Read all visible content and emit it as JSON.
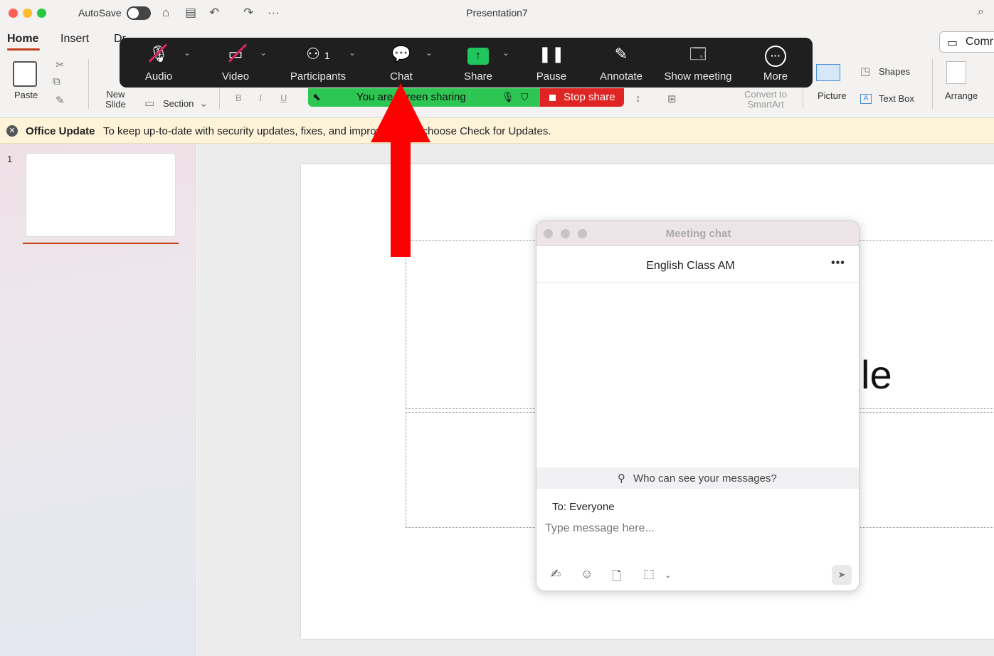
{
  "titlebar": {
    "autosave_label": "AutoSave",
    "more_glyph": "···",
    "document_title": "Presentation7",
    "icons": [
      "home-icon",
      "save-icon",
      "undo-icon",
      "redo-icon",
      "search-icon"
    ]
  },
  "ribbon": {
    "tabs": {
      "home": "Home",
      "insert": "Insert",
      "draw": "Dr"
    },
    "comments_label": "Comr",
    "paste_label": "Paste",
    "new_slide_label": "New\nSlide",
    "section_label": "Section",
    "bold_label": "B",
    "italic_label": "I",
    "underline_label": "U",
    "convert_label": "Convert to\nSmartArt",
    "picture_label": "Picture",
    "shapes_label": "Shapes",
    "textbox_label": "Text Box",
    "arrange_label": "Arrange"
  },
  "zoom_toolbar": {
    "buttons": [
      {
        "label": "Audio",
        "icon": "mic-muted-icon"
      },
      {
        "label": "Video",
        "icon": "video-off-icon"
      },
      {
        "label": "Participants",
        "icon": "participants-icon",
        "count": "1"
      },
      {
        "label": "Chat",
        "icon": "chat-icon"
      },
      {
        "label": "Share",
        "icon": "share-up-arrow-icon"
      },
      {
        "label": "Pause",
        "icon": "pause-icon"
      },
      {
        "label": "Annotate",
        "icon": "pencil-icon"
      },
      {
        "label": "Show meeting",
        "icon": "window-icon"
      },
      {
        "label": "More",
        "icon": "more-icon"
      }
    ],
    "share_banner_text": "You are screen sharing",
    "stop_share_label": "Stop share",
    "colors": {
      "bar": "#1f1f1f",
      "share_green": "#2dc653",
      "stop_red": "#e02424"
    }
  },
  "update_bar": {
    "title": "Office Update",
    "message": "To keep up-to-date with security updates, fixes, and improvements, choose Check for Updates."
  },
  "thumbnails": {
    "slide_number": "1"
  },
  "slide": {
    "visible_text": "le"
  },
  "chat": {
    "window_title": "Meeting chat",
    "group_name": "English Class AM",
    "more_glyph": "•••",
    "visibility_text": "Who can see your messages?",
    "to_label": "To: Everyone",
    "input_placeholder": "Type message here...",
    "tools": [
      "format-icon",
      "emoji-icon",
      "file-icon",
      "screenshot-icon"
    ]
  },
  "annotation": {
    "arrow_color": "#ff0000",
    "points_to": "Chat"
  }
}
